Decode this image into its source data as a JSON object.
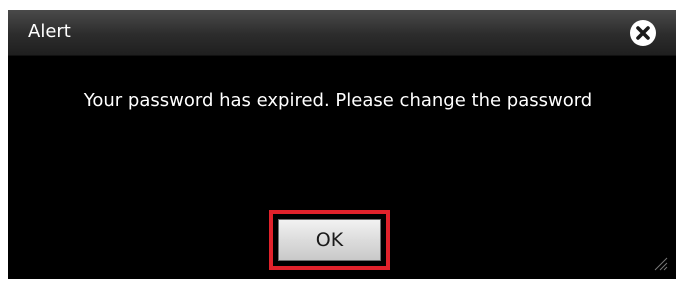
{
  "dialog": {
    "title": "Alert",
    "message": "Your password has expired. Please change the password",
    "ok_label": "OK",
    "colors": {
      "background": "#000000",
      "title_text": "#ffffff",
      "highlight": "#e1222b"
    }
  },
  "icons": {
    "close": "close-icon",
    "resize": "resize-grip-icon"
  }
}
